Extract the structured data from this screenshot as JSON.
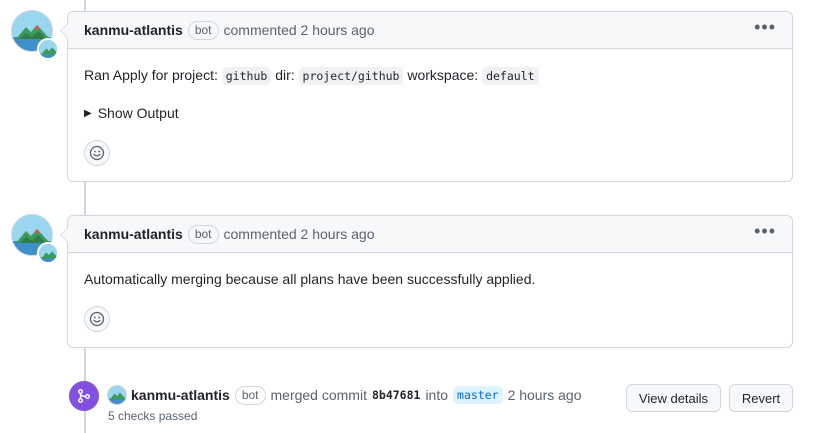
{
  "comments": [
    {
      "author": "kanmu-atlantis",
      "badge": "bot",
      "action": "commented 2 hours ago",
      "more_label": "•••",
      "body": {
        "prefix": "Ran Apply for project:",
        "project": "github",
        "dir_label": "dir:",
        "dir": "project/github",
        "workspace_label": "workspace:",
        "workspace": "default"
      },
      "details_label": "Show Output"
    },
    {
      "author": "kanmu-atlantis",
      "badge": "bot",
      "action": "commented 2 hours ago",
      "more_label": "•••",
      "body_text": "Automatically merging because all plans have been successfully applied."
    }
  ],
  "merge_event": {
    "author": "kanmu-atlantis",
    "badge": "bot",
    "action": "merged commit",
    "sha": "8b47681",
    "into_label": "into",
    "branch": "master",
    "time": "2 hours ago",
    "checks": "5 checks passed",
    "view_details_label": "View details",
    "revert_label": "Revert"
  },
  "icons": {
    "reaction": "smiley-icon",
    "merge": "git-merge-icon",
    "disclosure": "triangle-right-icon",
    "more": "kebab-horizontal-icon"
  },
  "colors": {
    "merge_purple": "#8250df",
    "branch_bg": "#ddf4ff",
    "branch_fg": "#0969da",
    "border": "#d0d7de"
  }
}
